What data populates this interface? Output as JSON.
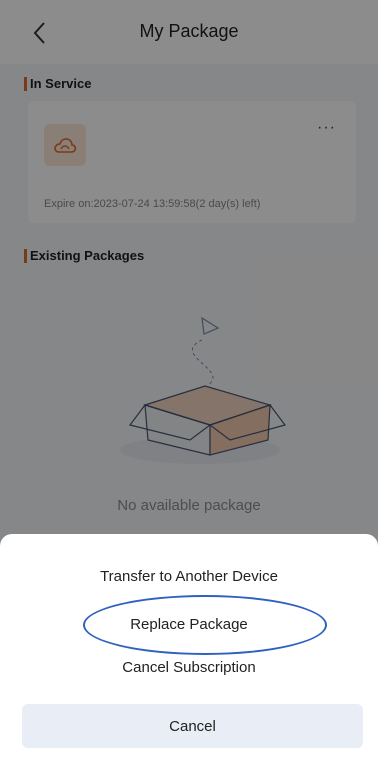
{
  "header": {
    "title": "My Package"
  },
  "in_service": {
    "heading": "In Service",
    "expire_text": "Expire on:2023-07-24 13:59:58(2 day(s) left)"
  },
  "existing": {
    "heading": "Existing Packages",
    "empty_text": "No available package"
  },
  "action_sheet": {
    "items": [
      {
        "label": "Transfer to Another Device"
      },
      {
        "label": "Replace Package"
      },
      {
        "label": "Cancel Subscription"
      }
    ],
    "cancel_label": "Cancel"
  },
  "colors": {
    "accent": "#e2692b",
    "highlight_circle": "#2f62bf",
    "cancel_bg": "#e9edf5"
  },
  "icons": {
    "back": "chevron-left-icon",
    "more": "more-dots-icon",
    "package": "cloud-icon"
  }
}
